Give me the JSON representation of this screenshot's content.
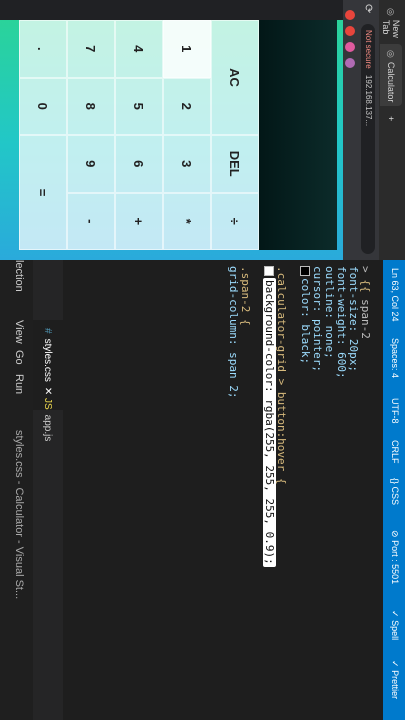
{
  "browser": {
    "tabs": [
      {
        "label": "New Tab"
      },
      {
        "label": "Calculator"
      }
    ],
    "security": "Not secure",
    "url": "192.168.137..."
  },
  "calculator": {
    "keys": [
      "AC",
      "DEL",
      "÷",
      "1",
      "2",
      "3",
      "*",
      "4",
      "5",
      "6",
      "+",
      "7",
      "8",
      "9",
      "-",
      ".",
      "0",
      "="
    ]
  },
  "editor": {
    "tabs": [
      {
        "label": "styles.css",
        "active": true
      },
      {
        "label": "app.js",
        "active": false
      }
    ],
    "breadcrumb_tail": "span-2",
    "code": [
      "font-size: 20px;",
      "font-weight: 600;",
      "outline: none;",
      "cursor: pointer;",
      "color: black;",
      "",
      ".calculator-grid > button:hover {",
      "background-color: rgba(255, 255, 255, 0.9);",
      "",
      ".span-2 {",
      "grid-column: span 2;"
    ],
    "window_title": "styles.css - Calculator - Visual St..."
  },
  "menubar": {
    "items": [
      "lection",
      "View",
      "Go",
      "Run"
    ]
  },
  "statusbar": {
    "items": [
      "Ln 63, Col 24",
      "Spaces: 4",
      "UTF-8",
      "CRLF",
      "CSS",
      "Port : 5501",
      "Spell",
      "Prettier"
    ]
  }
}
